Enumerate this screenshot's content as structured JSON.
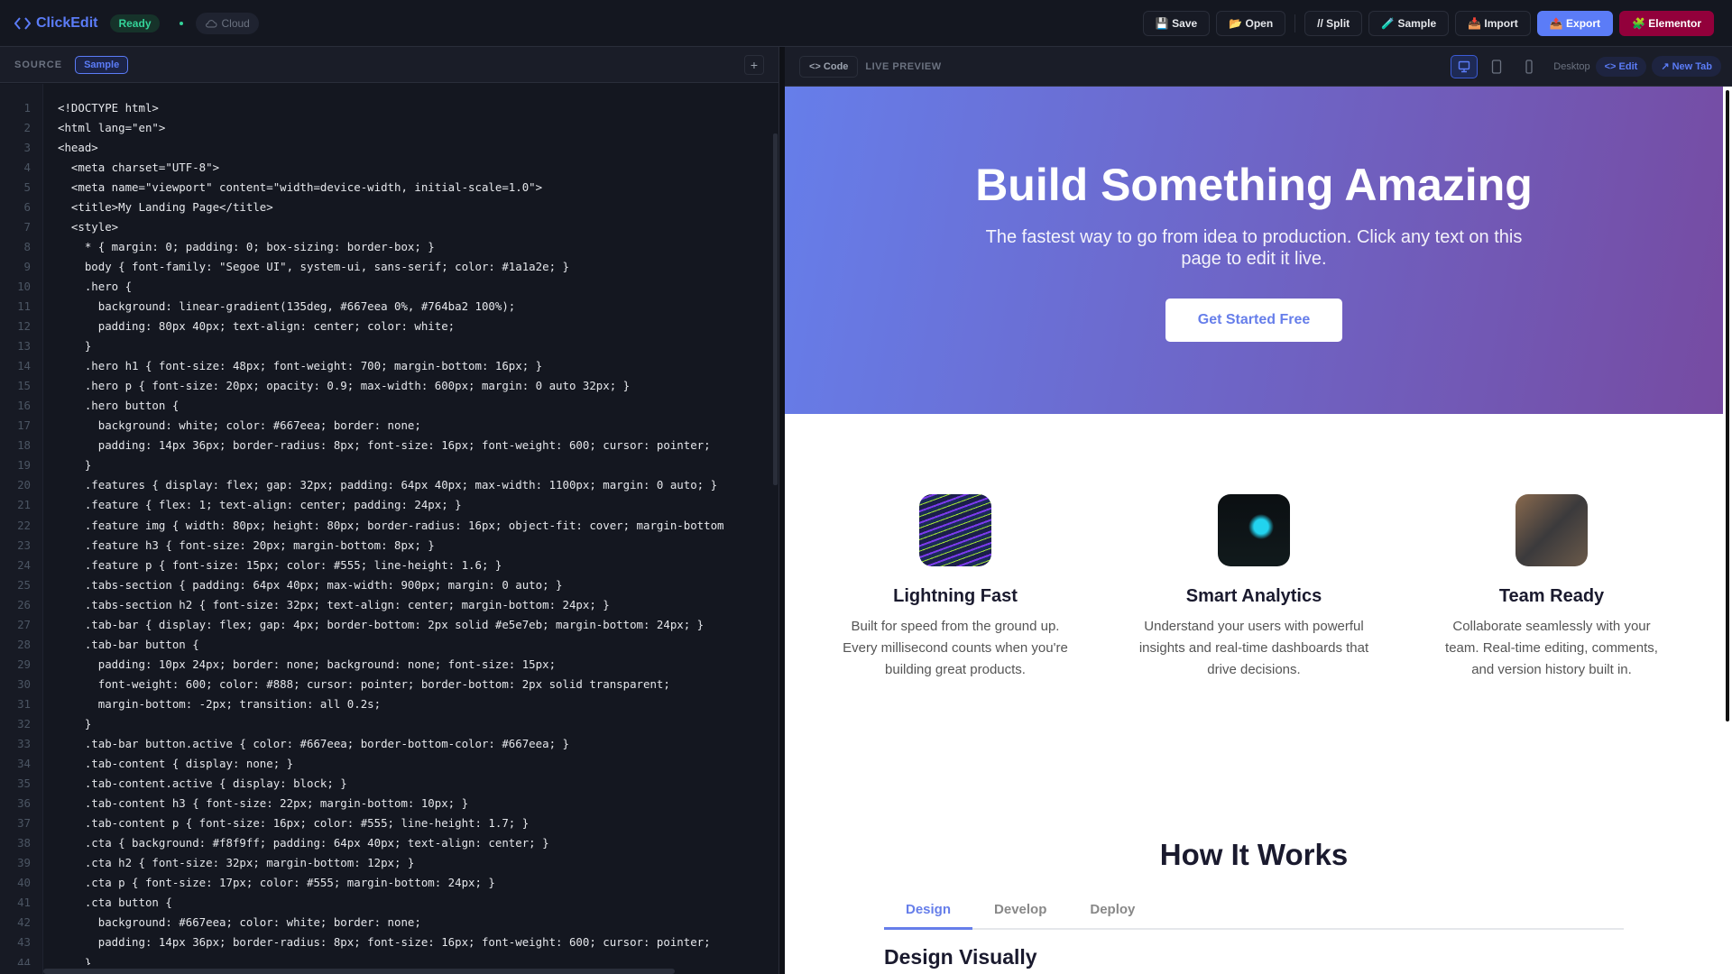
{
  "topbar": {
    "app_name": "ClickEdit",
    "status": "Ready",
    "cloud": "Cloud",
    "buttons": {
      "save": "💾 Save",
      "open": "📂 Open",
      "split": "// Split",
      "sample": "🧪 Sample",
      "import": "📥 Import",
      "export": "📤 Export",
      "elementor": "🧩 Elementor"
    }
  },
  "source": {
    "label": "SOURCE",
    "badge": "Sample",
    "add": "+",
    "lines": [
      "<!DOCTYPE html>",
      "<html lang=\"en\">",
      "<head>",
      "  <meta charset=\"UTF-8\">",
      "  <meta name=\"viewport\" content=\"width=device-width, initial-scale=1.0\">",
      "  <title>My Landing Page</title>",
      "  <style>",
      "    * { margin: 0; padding: 0; box-sizing: border-box; }",
      "    body { font-family: \"Segoe UI\", system-ui, sans-serif; color: #1a1a2e; }",
      "    .hero {",
      "      background: linear-gradient(135deg, #667eea 0%, #764ba2 100%);",
      "      padding: 80px 40px; text-align: center; color: white;",
      "    }",
      "    .hero h1 { font-size: 48px; font-weight: 700; margin-bottom: 16px; }",
      "    .hero p { font-size: 20px; opacity: 0.9; max-width: 600px; margin: 0 auto 32px; }",
      "    .hero button {",
      "      background: white; color: #667eea; border: none;",
      "      padding: 14px 36px; border-radius: 8px; font-size: 16px; font-weight: 600; cursor: pointer;",
      "    }",
      "    .features { display: flex; gap: 32px; padding: 64px 40px; max-width: 1100px; margin: 0 auto; }",
      "    .feature { flex: 1; text-align: center; padding: 24px; }",
      "    .feature img { width: 80px; height: 80px; border-radius: 16px; object-fit: cover; margin-bottom",
      "    .feature h3 { font-size: 20px; margin-bottom: 8px; }",
      "    .feature p { font-size: 15px; color: #555; line-height: 1.6; }",
      "    .tabs-section { padding: 64px 40px; max-width: 900px; margin: 0 auto; }",
      "    .tabs-section h2 { font-size: 32px; text-align: center; margin-bottom: 24px; }",
      "    .tab-bar { display: flex; gap: 4px; border-bottom: 2px solid #e5e7eb; margin-bottom: 24px; }",
      "    .tab-bar button {",
      "      padding: 10px 24px; border: none; background: none; font-size: 15px;",
      "      font-weight: 600; color: #888; cursor: pointer; border-bottom: 2px solid transparent;",
      "      margin-bottom: -2px; transition: all 0.2s;",
      "    }",
      "    .tab-bar button.active { color: #667eea; border-bottom-color: #667eea; }",
      "    .tab-content { display: none; }",
      "    .tab-content.active { display: block; }",
      "    .tab-content h3 { font-size: 22px; margin-bottom: 10px; }",
      "    .tab-content p { font-size: 16px; color: #555; line-height: 1.7; }",
      "    .cta { background: #f8f9ff; padding: 64px 40px; text-align: center; }",
      "    .cta h2 { font-size: 32px; margin-bottom: 12px; }",
      "    .cta p { font-size: 17px; color: #555; margin-bottom: 24px; }",
      "    .cta button {",
      "      background: #667eea; color: white; border: none;",
      "      padding: 14px 36px; border-radius: 8px; font-size: 16px; font-weight: 600; cursor: pointer;",
      "    }"
    ]
  },
  "preview": {
    "code_button": "<> Code",
    "label": "LIVE PREVIEW",
    "device": "Desktop",
    "edit": "<> Edit",
    "new_tab": "↗ New Tab",
    "hero": {
      "title": "Build Something Amazing",
      "subtitle": "The fastest way to go from idea to production. Click any text on this page to edit it live.",
      "button": "Get Started Free"
    },
    "features": [
      {
        "title": "Lightning Fast",
        "text": "Built for speed from the ground up. Every millisecond counts when you're building great products."
      },
      {
        "title": "Smart Analytics",
        "text": "Understand your users with powerful insights and real-time dashboards that drive decisions."
      },
      {
        "title": "Team Ready",
        "text": "Collaborate seamlessly with your team. Real-time editing, comments, and version history built in."
      }
    ],
    "how": {
      "title": "How It Works",
      "tabs": [
        "Design",
        "Develop",
        "Deploy"
      ],
      "active_tab": "Design",
      "content_title": "Design Visually"
    }
  },
  "colors": {
    "accent": "#5b7cf7",
    "hero_start": "#667eea",
    "hero_end": "#764ba2",
    "elementor": "#92003b",
    "ready": "#34d399"
  }
}
